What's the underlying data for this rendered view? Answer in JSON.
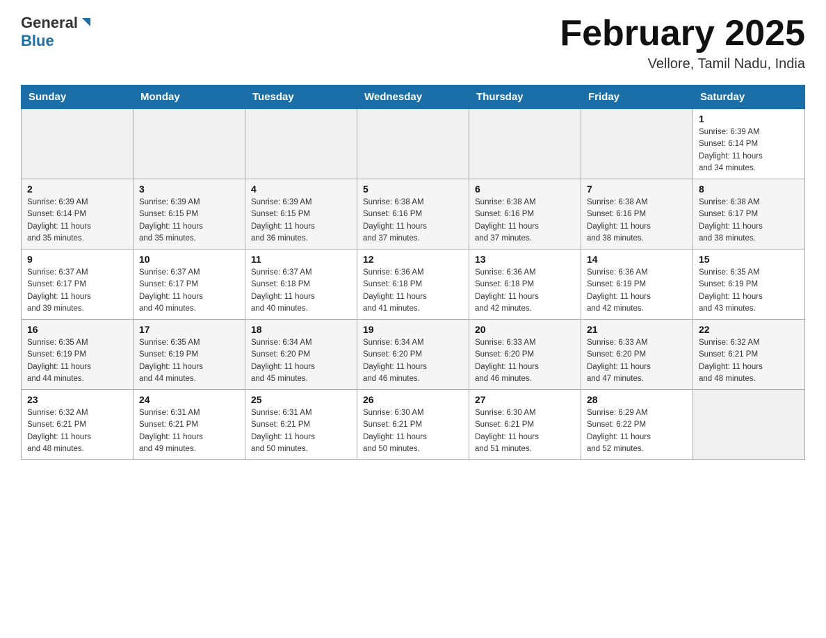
{
  "logo": {
    "general": "General",
    "blue": "Blue"
  },
  "header": {
    "title": "February 2025",
    "location": "Vellore, Tamil Nadu, India"
  },
  "days_of_week": [
    "Sunday",
    "Monday",
    "Tuesday",
    "Wednesday",
    "Thursday",
    "Friday",
    "Saturday"
  ],
  "weeks": [
    [
      {
        "day": "",
        "info": ""
      },
      {
        "day": "",
        "info": ""
      },
      {
        "day": "",
        "info": ""
      },
      {
        "day": "",
        "info": ""
      },
      {
        "day": "",
        "info": ""
      },
      {
        "day": "",
        "info": ""
      },
      {
        "day": "1",
        "info": "Sunrise: 6:39 AM\nSunset: 6:14 PM\nDaylight: 11 hours\nand 34 minutes."
      }
    ],
    [
      {
        "day": "2",
        "info": "Sunrise: 6:39 AM\nSunset: 6:14 PM\nDaylight: 11 hours\nand 35 minutes."
      },
      {
        "day": "3",
        "info": "Sunrise: 6:39 AM\nSunset: 6:15 PM\nDaylight: 11 hours\nand 35 minutes."
      },
      {
        "day": "4",
        "info": "Sunrise: 6:39 AM\nSunset: 6:15 PM\nDaylight: 11 hours\nand 36 minutes."
      },
      {
        "day": "5",
        "info": "Sunrise: 6:38 AM\nSunset: 6:16 PM\nDaylight: 11 hours\nand 37 minutes."
      },
      {
        "day": "6",
        "info": "Sunrise: 6:38 AM\nSunset: 6:16 PM\nDaylight: 11 hours\nand 37 minutes."
      },
      {
        "day": "7",
        "info": "Sunrise: 6:38 AM\nSunset: 6:16 PM\nDaylight: 11 hours\nand 38 minutes."
      },
      {
        "day": "8",
        "info": "Sunrise: 6:38 AM\nSunset: 6:17 PM\nDaylight: 11 hours\nand 38 minutes."
      }
    ],
    [
      {
        "day": "9",
        "info": "Sunrise: 6:37 AM\nSunset: 6:17 PM\nDaylight: 11 hours\nand 39 minutes."
      },
      {
        "day": "10",
        "info": "Sunrise: 6:37 AM\nSunset: 6:17 PM\nDaylight: 11 hours\nand 40 minutes."
      },
      {
        "day": "11",
        "info": "Sunrise: 6:37 AM\nSunset: 6:18 PM\nDaylight: 11 hours\nand 40 minutes."
      },
      {
        "day": "12",
        "info": "Sunrise: 6:36 AM\nSunset: 6:18 PM\nDaylight: 11 hours\nand 41 minutes."
      },
      {
        "day": "13",
        "info": "Sunrise: 6:36 AM\nSunset: 6:18 PM\nDaylight: 11 hours\nand 42 minutes."
      },
      {
        "day": "14",
        "info": "Sunrise: 6:36 AM\nSunset: 6:19 PM\nDaylight: 11 hours\nand 42 minutes."
      },
      {
        "day": "15",
        "info": "Sunrise: 6:35 AM\nSunset: 6:19 PM\nDaylight: 11 hours\nand 43 minutes."
      }
    ],
    [
      {
        "day": "16",
        "info": "Sunrise: 6:35 AM\nSunset: 6:19 PM\nDaylight: 11 hours\nand 44 minutes."
      },
      {
        "day": "17",
        "info": "Sunrise: 6:35 AM\nSunset: 6:19 PM\nDaylight: 11 hours\nand 44 minutes."
      },
      {
        "day": "18",
        "info": "Sunrise: 6:34 AM\nSunset: 6:20 PM\nDaylight: 11 hours\nand 45 minutes."
      },
      {
        "day": "19",
        "info": "Sunrise: 6:34 AM\nSunset: 6:20 PM\nDaylight: 11 hours\nand 46 minutes."
      },
      {
        "day": "20",
        "info": "Sunrise: 6:33 AM\nSunset: 6:20 PM\nDaylight: 11 hours\nand 46 minutes."
      },
      {
        "day": "21",
        "info": "Sunrise: 6:33 AM\nSunset: 6:20 PM\nDaylight: 11 hours\nand 47 minutes."
      },
      {
        "day": "22",
        "info": "Sunrise: 6:32 AM\nSunset: 6:21 PM\nDaylight: 11 hours\nand 48 minutes."
      }
    ],
    [
      {
        "day": "23",
        "info": "Sunrise: 6:32 AM\nSunset: 6:21 PM\nDaylight: 11 hours\nand 48 minutes."
      },
      {
        "day": "24",
        "info": "Sunrise: 6:31 AM\nSunset: 6:21 PM\nDaylight: 11 hours\nand 49 minutes."
      },
      {
        "day": "25",
        "info": "Sunrise: 6:31 AM\nSunset: 6:21 PM\nDaylight: 11 hours\nand 50 minutes."
      },
      {
        "day": "26",
        "info": "Sunrise: 6:30 AM\nSunset: 6:21 PM\nDaylight: 11 hours\nand 50 minutes."
      },
      {
        "day": "27",
        "info": "Sunrise: 6:30 AM\nSunset: 6:21 PM\nDaylight: 11 hours\nand 51 minutes."
      },
      {
        "day": "28",
        "info": "Sunrise: 6:29 AM\nSunset: 6:22 PM\nDaylight: 11 hours\nand 52 minutes."
      },
      {
        "day": "",
        "info": ""
      }
    ]
  ]
}
